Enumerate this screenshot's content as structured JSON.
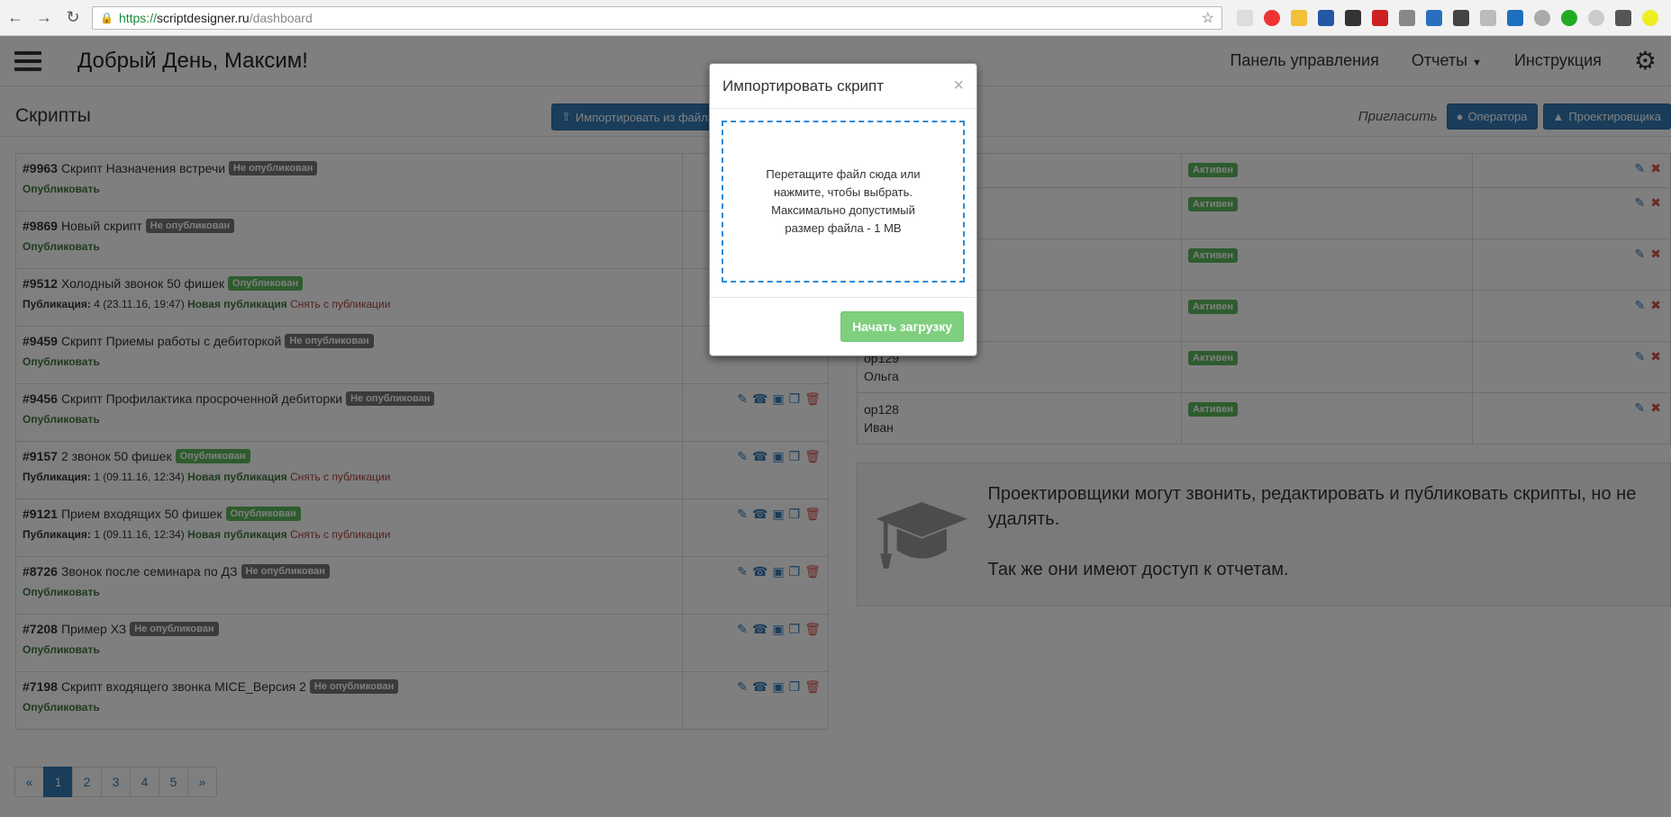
{
  "browser": {
    "url_protocol": "https://",
    "url_host": "scriptdesigner.ru",
    "url_path": "/dashboard",
    "back_icon": "arrow-left",
    "forward_icon": "arrow-right",
    "reload_icon": "reload"
  },
  "header": {
    "greeting": "Добрый День, Максим!",
    "nav": {
      "dashboard": "Панель управления",
      "reports": "Отчеты",
      "instructions": "Инструкция"
    }
  },
  "scripts_section": {
    "title": "Скрипты",
    "import_button": "Импортировать из файла"
  },
  "invite": {
    "label": "Пригласить",
    "operator_button": "Оператора",
    "designer_button": "Проектировщика"
  },
  "scripts": [
    {
      "id": "#9963",
      "name": "Скрипт Назначения встречи",
      "status": "Не опубликован",
      "published": false,
      "action": "Опубликовать"
    },
    {
      "id": "#9869",
      "name": "Новый скрипт",
      "status": "Не опубликован",
      "published": false,
      "action": "Опубликовать"
    },
    {
      "id": "#9512",
      "name": "Холодный звонок 50 фишек",
      "status": "Опубликован",
      "published": true,
      "pub_label": "Публикация:",
      "pub_info": "4 (23.11.16, 19:47)",
      "new_pub": "Новая публикация",
      "unpub": "Снять с публикации"
    },
    {
      "id": "#9459",
      "name": "Скрипт Приемы работы с дебиторкой",
      "status": "Не опубликован",
      "published": false,
      "action": "Опубликовать"
    },
    {
      "id": "#9456",
      "name": "Скрипт Профилактика просроченной дебиторки",
      "status": "Не опубликован",
      "published": false,
      "action": "Опубликовать"
    },
    {
      "id": "#9157",
      "name": "2 звонок 50 фишек",
      "status": "Опубликован",
      "published": true,
      "pub_label": "Публикация:",
      "pub_info": "1 (09.11.16, 12:34)",
      "new_pub": "Новая публикация",
      "unpub": "Снять с публикации"
    },
    {
      "id": "#9121",
      "name": "Прием входящих 50 фишек",
      "status": "Опубликован",
      "published": true,
      "pub_label": "Публикация:",
      "pub_info": "1 (09.11.16, 12:34)",
      "new_pub": "Новая публикация",
      "unpub": "Снять с публикации"
    },
    {
      "id": "#8726",
      "name": "Звонок после семинара по ДЗ",
      "status": "Не опубликован",
      "published": false,
      "action": "Опубликовать"
    },
    {
      "id": "#7208",
      "name": "Пример ХЗ",
      "status": "Не опубликован",
      "published": false,
      "action": "Опубликовать"
    },
    {
      "id": "#7198",
      "name": "Скрипт входящего звонка MICE_Версия 2",
      "status": "Не опубликован",
      "published": false,
      "action": "Опубликовать"
    }
  ],
  "pagination": [
    "«",
    "1",
    "2",
    "3",
    "4",
    "5",
    "»"
  ],
  "pagination_active": "1",
  "operators": [
    {
      "login": "",
      "name": "",
      "status": "Активен"
    },
    {
      "login": "",
      "name": "",
      "status": "Активен"
    },
    {
      "login": "",
      "name": "",
      "status": "Активен"
    },
    {
      "login": "",
      "name": "",
      "status": "Активен"
    },
    {
      "login": "op129",
      "name": "Ольга",
      "status": "Активен"
    },
    {
      "login": "op128",
      "name": "Иван",
      "status": "Активен"
    }
  ],
  "info": {
    "line1": "Проектировщики могут звонить, редактировать и публиковать скрипты, но не удалять.",
    "line2": "Так же они имеют доступ к отчетам."
  },
  "modal": {
    "title": "Импортировать скрипт",
    "close": "×",
    "dropzone_text": "Перетащите файл сюда или нажмите, чтобы выбрать. Максимально допустимый размер файла - 1 MB",
    "upload_button": "Начать загрузку"
  },
  "colors": {
    "primary": "#337ab7",
    "success": "#5cb85c",
    "danger": "#d9534f",
    "draft_badge": "#777777"
  }
}
